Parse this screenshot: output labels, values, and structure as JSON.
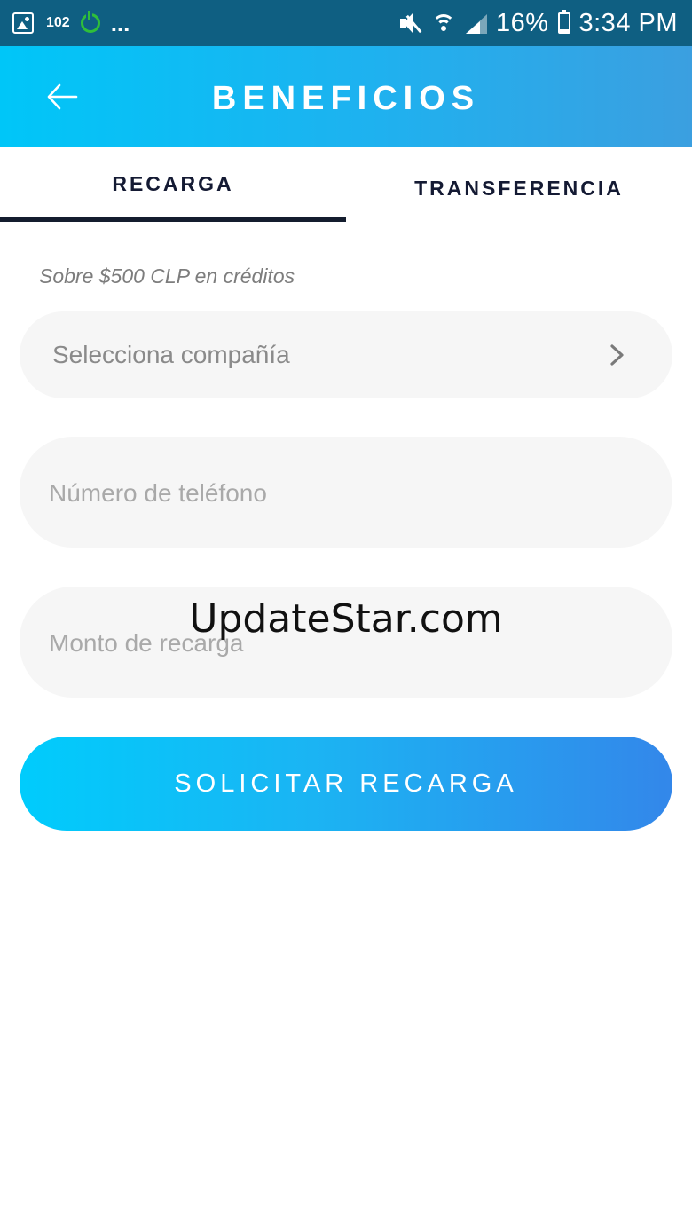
{
  "status_bar": {
    "notification_count": "102",
    "more": "...",
    "battery": "16%",
    "time": "3:34 PM",
    "icons": [
      "image-icon",
      "power-icon",
      "mute-icon",
      "wifi-icon",
      "signal-icon",
      "battery-charging-icon"
    ]
  },
  "header": {
    "title": "BENEFICIOS",
    "back_icon": "arrow-left-icon"
  },
  "tabs": [
    {
      "label": "RECARGA",
      "active": true
    },
    {
      "label": "TRANSFERENCIA",
      "active": false
    }
  ],
  "form": {
    "hint": "Sobre $500 CLP en créditos",
    "company": {
      "placeholder": "Selecciona compañía",
      "icon": "chevron-right-icon"
    },
    "phone": {
      "placeholder": "Número de teléfono"
    },
    "amount": {
      "placeholder": "Monto de recarga"
    },
    "submit_label": "SOLICITAR RECARGA"
  },
  "watermark": "UpdateStar.com",
  "colors": {
    "header_gradient_start": "#00c6f8",
    "header_gradient_end": "#3b9fe0",
    "tab_text": "#141a33",
    "button_gradient_start": "#00ccfc",
    "button_gradient_end": "#3387ea",
    "field_bg": "#f6f6f6"
  }
}
